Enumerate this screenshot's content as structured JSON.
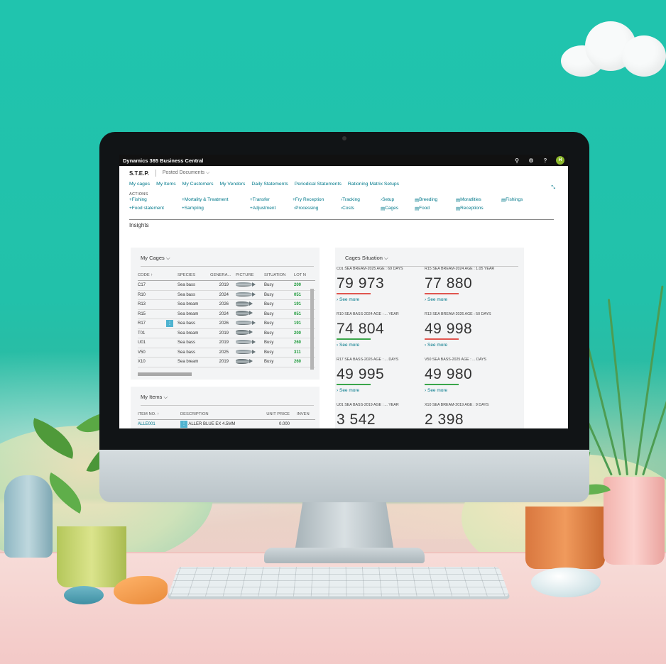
{
  "app": {
    "title": "Dynamics 365 Business Central",
    "avatar_initial": "H",
    "icons": [
      "search-icon",
      "settings-icon",
      "help-icon"
    ],
    "help_label": "?",
    "accent": "#00788a",
    "avatar_color": "#8cb82b"
  },
  "role_center": {
    "title": "S.T.E.P.",
    "sub_menu": "Posted Documents",
    "nav": [
      "My cages",
      "My Items",
      "My Customers",
      "My Vendors",
      "Daily Statements",
      "Periodical Statements",
      "Rationing Matrix Setups"
    ],
    "actions_label": "ACTIONS",
    "actions": {
      "fishing": "Fishing",
      "food_statement": "Food statement",
      "mortality": "Mortality & Treatment",
      "sampling": "Sampling",
      "transfer": "Transfer",
      "adjustment": "Adjustment",
      "fry_reception": "Fry Reception",
      "processing": "Processing",
      "tracking": "Tracking",
      "costs": "Costs",
      "setup": "Setup",
      "cages": "Cages",
      "breeding": "Breeding",
      "food": "Food",
      "moratlities": "Moratlities",
      "receptions": "Receptions",
      "fishings": "Fishings"
    },
    "insights": "Insights"
  },
  "my_cages": {
    "title": "My Cages",
    "columns": [
      "CODE ↑",
      "SPECIES",
      "GENERA...",
      "PICTURE",
      "SITUATION",
      "LOT N"
    ],
    "rows": [
      {
        "code": "C17",
        "species": "Sea bass",
        "gen": "2019",
        "pic": "bass",
        "situation": "Busy",
        "lot": "200"
      },
      {
        "code": "R10",
        "species": "Sea bass",
        "gen": "2024",
        "pic": "bass",
        "situation": "Busy",
        "lot": "051"
      },
      {
        "code": "R13",
        "species": "Sea bream",
        "gen": "2026",
        "pic": "bream",
        "situation": "Busy",
        "lot": "191"
      },
      {
        "code": "R15",
        "species": "Sea bream",
        "gen": "2024",
        "pic": "bream",
        "situation": "Busy",
        "lot": "051"
      },
      {
        "code": "R17",
        "species": "Sea bass",
        "gen": "2026",
        "pic": "bass",
        "situation": "Busy",
        "lot": "191"
      },
      {
        "code": "T01",
        "species": "Sea bream",
        "gen": "2019",
        "pic": "bream",
        "situation": "Busy",
        "lot": "200"
      },
      {
        "code": "U01",
        "species": "Sea bass",
        "gen": "2019",
        "pic": "bass",
        "situation": "Busy",
        "lot": "260"
      },
      {
        "code": "V50",
        "species": "Sea bass",
        "gen": "2025",
        "pic": "bass",
        "situation": "Busy",
        "lot": "311"
      },
      {
        "code": "X10",
        "species": "Sea bream",
        "gen": "2019",
        "pic": "bream",
        "situation": "Busy",
        "lot": "260"
      }
    ]
  },
  "my_items": {
    "title": "My Items",
    "columns": [
      "ITEM NO. ↑",
      "DESCRIPTION",
      "UNIT PRICE",
      "INVEN"
    ],
    "rows": [
      {
        "no": "ALLE001",
        "desc": "ALLER BLUE EX 4.5MM",
        "price": "0.000"
      }
    ]
  },
  "cages_situation": {
    "title": "Cages Situation",
    "see_more": "See more",
    "tiles": [
      {
        "caption": "C01 SEA BREAM-2025 AGE : 69 DAYS",
        "value": "79 973",
        "bar": "#e0554f"
      },
      {
        "caption": "R15 SEA BREAM-2024 AGE : 1.05 YEAR",
        "value": "77 880",
        "bar": "#e0554f"
      },
      {
        "caption": "R10 SEA BASS-2024 AGE : ... YEAR",
        "value": "74 804",
        "bar": "#3aa64a"
      },
      {
        "caption": "R13 SEA BREAM-2026 AGE : 50 DAYS",
        "value": "49 998",
        "bar": "#e0554f"
      },
      {
        "caption": "R17 SEA BASS-2026 AGE : ... DAYS",
        "value": "49 995",
        "bar": "#3aa64a"
      },
      {
        "caption": "V50 SEA BASS-2025 AGE : ... DAYS",
        "value": "49 980",
        "bar": "#3aa64a"
      },
      {
        "caption": "U01 SEA BASS-2019 AGE : ... YEAR",
        "value": "3 542",
        "bar": ""
      },
      {
        "caption": "X10 SEA BREAM-2019 AGE : 9 DAYS",
        "value": "2 398",
        "bar": ""
      }
    ]
  }
}
